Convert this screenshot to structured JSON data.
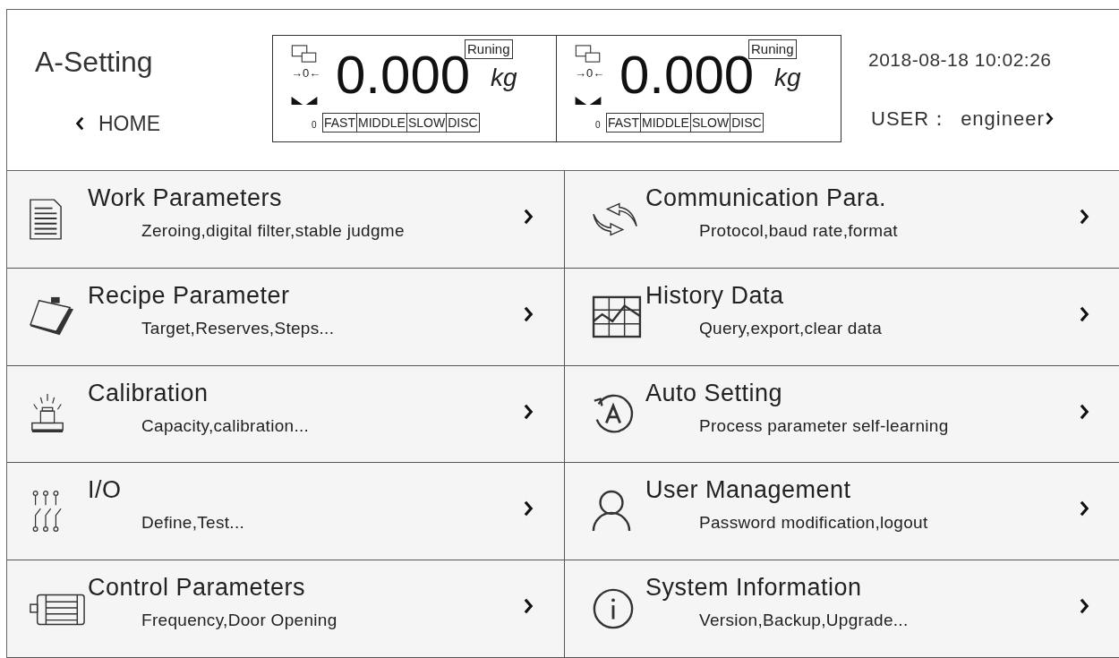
{
  "header": {
    "title": "A-Setting",
    "home": "HOME",
    "datetime": "2018-08-18 10:02:26",
    "user_label": "USER：",
    "user": "engineer"
  },
  "displays": [
    {
      "status": "Runing",
      "zero_mark": "→0←",
      "weight": "0.000",
      "unit": "kg",
      "index": "0",
      "stages": [
        "FAST",
        "MIDDLE",
        "SLOW",
        "DISC"
      ]
    },
    {
      "status": "Runing",
      "zero_mark": "→0←",
      "weight": "0.000",
      "unit": "kg",
      "index": "0",
      "stages": [
        "FAST",
        "MIDDLE",
        "SLOW",
        "DISC"
      ]
    }
  ],
  "menu": [
    {
      "title": "Work Parameters",
      "subtitle": "Zeroing,digital filter,stable judgme"
    },
    {
      "title": "Communication Para.",
      "subtitle": "Protocol,baud rate,format"
    },
    {
      "title": "Recipe Parameter",
      "subtitle": "Target,Reserves,Steps..."
    },
    {
      "title": "History Data",
      "subtitle": "Query,export,clear data"
    },
    {
      "title": "Calibration",
      "subtitle": "Capacity,calibration..."
    },
    {
      "title": "Auto Setting",
      "subtitle": "Process parameter self-learning"
    },
    {
      "title": "I/O",
      "subtitle": "Define,Test..."
    },
    {
      "title": "User Management",
      "subtitle": "Password modification,logout"
    },
    {
      "title": "Control Parameters",
      "subtitle": "Frequency,Door Opening"
    },
    {
      "title": "System Information",
      "subtitle": "Version,Backup,Upgrade..."
    }
  ]
}
